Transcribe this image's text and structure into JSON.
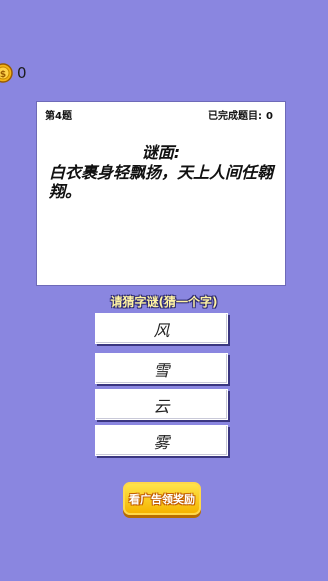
{
  "coins": {
    "count": "0"
  },
  "card": {
    "level": "第4题",
    "done_label": "已完成题目:",
    "done_count": "0",
    "riddle_head": "谜面:",
    "riddle_text": "白衣裹身轻飘扬，天上人间任翱翔。"
  },
  "prompt": "请猜字谜(猜一个字)",
  "options": [
    "风",
    "雪",
    "云",
    "雾"
  ],
  "ad_button": "看广告领奖励",
  "colors": {
    "background": "#8a86e0",
    "prompt_text": "#fff3a3",
    "ad_button": "#f5b400"
  },
  "icons": {
    "coin": "gold-coin-icon"
  }
}
